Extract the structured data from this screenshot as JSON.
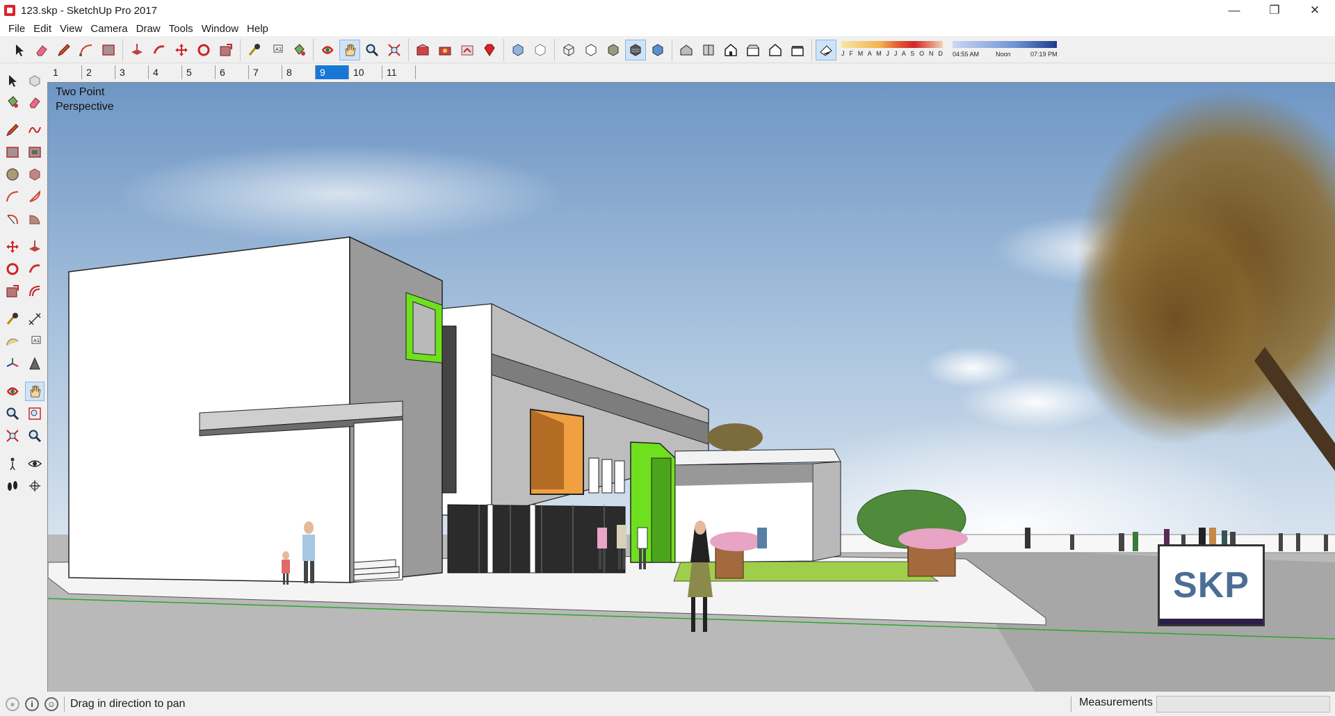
{
  "window": {
    "title": "123.skp - SketchUp Pro 2017",
    "minimize": "—",
    "restore": "❐",
    "close": "✕"
  },
  "menu": [
    "File",
    "Edit",
    "View",
    "Camera",
    "Draw",
    "Tools",
    "Window",
    "Help"
  ],
  "scene_tabs": [
    "1",
    "2",
    "3",
    "4",
    "5",
    "6",
    "7",
    "8",
    "9",
    "10",
    "11"
  ],
  "active_scene_tab": "9",
  "shadow": {
    "months": "J F M A M J J A S O N D",
    "time_start": "04:55 AM",
    "time_mid": "Noon",
    "time_end": "07:19 PM"
  },
  "viewport": {
    "label_line1": "Two Point",
    "label_line2": "Perspective",
    "logo": "SKP"
  },
  "status": {
    "hint": "Drag in direction to pan",
    "measurements_label": "Measurements",
    "measurements_value": ""
  },
  "colors": {
    "accent_green": "#6ee01e",
    "selection_blue": "#1877d6",
    "sky": "#8fb1d3"
  }
}
